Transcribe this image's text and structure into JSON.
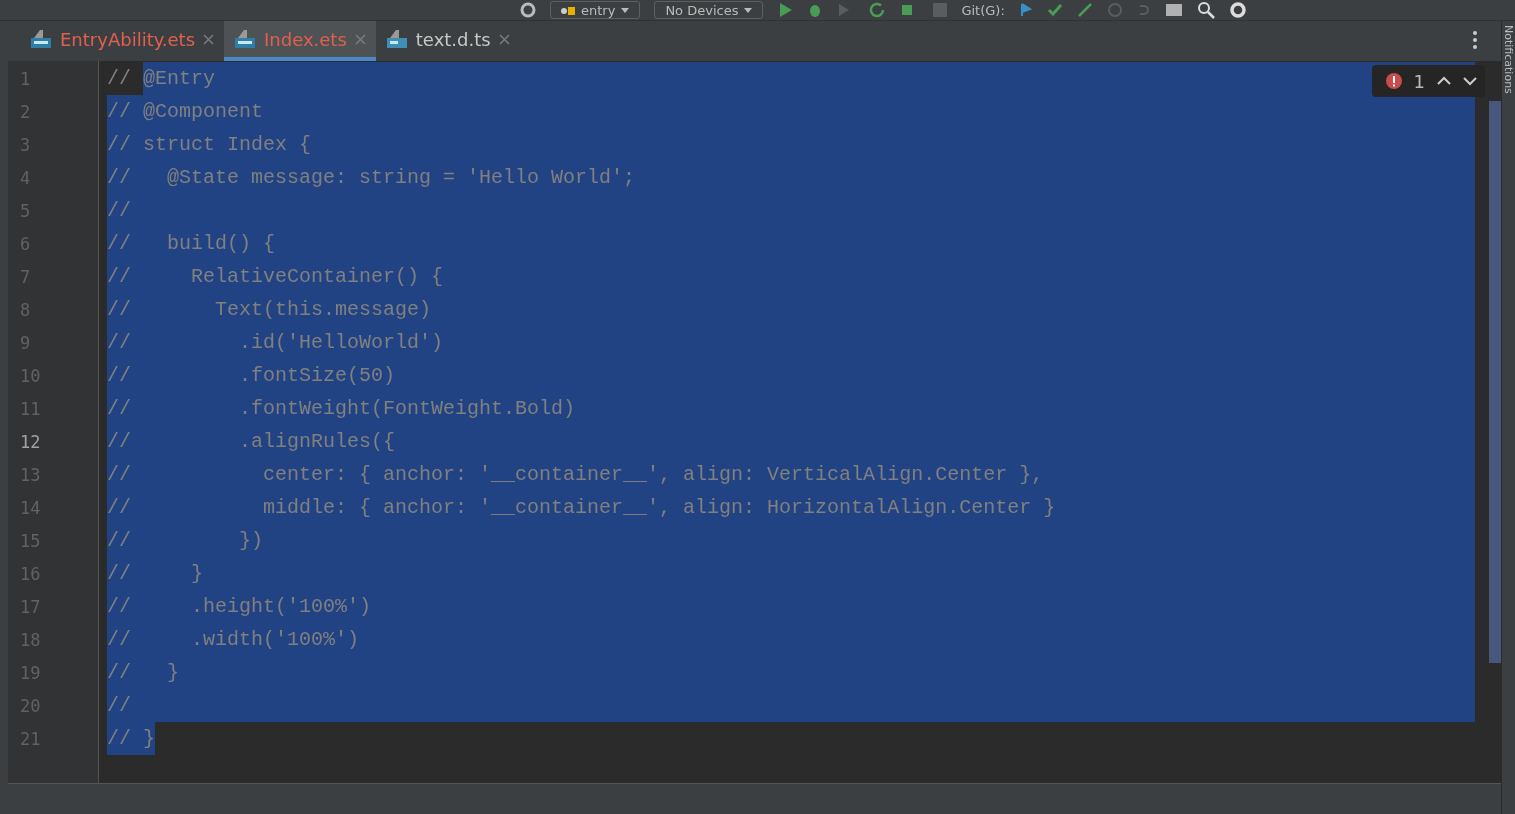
{
  "toolbar": {
    "module": "entry",
    "device": "No Devices",
    "vcs_label": "Git(G):"
  },
  "tabs": [
    {
      "label": "EntryAbility.ets",
      "kind": "ets",
      "modified": true,
      "selected": false
    },
    {
      "label": "Index.ets",
      "kind": "ets",
      "modified": true,
      "selected": true
    },
    {
      "label": "text.d.ts",
      "kind": "ts",
      "modified": false,
      "selected": false
    }
  ],
  "problems": {
    "errors": "1"
  },
  "side_panel": {
    "label": "Notifications"
  },
  "lines": [
    {
      "number": "1",
      "current": false,
      "eol_selected": true,
      "segments": [
        {
          "text": "// ",
          "selected": false
        },
        {
          "text": "@Entry",
          "selected": true
        }
      ]
    },
    {
      "number": "2",
      "current": false,
      "eol_selected": true,
      "segments": [
        {
          "text": "// @Component",
          "selected": true
        }
      ]
    },
    {
      "number": "3",
      "current": false,
      "eol_selected": true,
      "segments": [
        {
          "text": "// struct Index {",
          "selected": true
        }
      ]
    },
    {
      "number": "4",
      "current": false,
      "eol_selected": true,
      "segments": [
        {
          "text": "//   @State message: string = 'Hello World';",
          "selected": true
        }
      ]
    },
    {
      "number": "5",
      "current": false,
      "eol_selected": true,
      "segments": [
        {
          "text": "//",
          "selected": true
        }
      ]
    },
    {
      "number": "6",
      "current": false,
      "eol_selected": true,
      "segments": [
        {
          "text": "//   build() {",
          "selected": true
        }
      ]
    },
    {
      "number": "7",
      "current": false,
      "eol_selected": true,
      "segments": [
        {
          "text": "//     RelativeContainer() {",
          "selected": true
        }
      ]
    },
    {
      "number": "8",
      "current": false,
      "eol_selected": true,
      "segments": [
        {
          "text": "//       Text(this.message)",
          "selected": true
        }
      ]
    },
    {
      "number": "9",
      "current": false,
      "eol_selected": true,
      "segments": [
        {
          "text": "//         .id('HelloWorld')",
          "selected": true
        }
      ]
    },
    {
      "number": "10",
      "current": false,
      "eol_selected": true,
      "segments": [
        {
          "text": "//         .fontSize(50)",
          "selected": true
        }
      ]
    },
    {
      "number": "11",
      "current": false,
      "eol_selected": true,
      "segments": [
        {
          "text": "//         .fontWeight(FontWeight.Bold)",
          "selected": true
        }
      ]
    },
    {
      "number": "12",
      "current": true,
      "eol_selected": true,
      "segments": [
        {
          "text": "//         .alignRules({",
          "selected": true
        }
      ]
    },
    {
      "number": "13",
      "current": false,
      "eol_selected": true,
      "segments": [
        {
          "text": "//           center: { anchor: '__container__', align: VerticalAlign.Center },",
          "selected": true
        }
      ]
    },
    {
      "number": "14",
      "current": false,
      "eol_selected": true,
      "segments": [
        {
          "text": "//           middle: { anchor: '__container__', align: HorizontalAlign.Center }",
          "selected": true
        }
      ]
    },
    {
      "number": "15",
      "current": false,
      "eol_selected": true,
      "segments": [
        {
          "text": "//         })",
          "selected": true
        }
      ]
    },
    {
      "number": "16",
      "current": false,
      "eol_selected": true,
      "segments": [
        {
          "text": "//     }",
          "selected": true
        }
      ]
    },
    {
      "number": "17",
      "current": false,
      "eol_selected": true,
      "segments": [
        {
          "text": "//     .height('100%')",
          "selected": true
        }
      ]
    },
    {
      "number": "18",
      "current": false,
      "eol_selected": true,
      "segments": [
        {
          "text": "//     .width('100%')",
          "selected": true
        }
      ]
    },
    {
      "number": "19",
      "current": false,
      "eol_selected": true,
      "segments": [
        {
          "text": "//   }",
          "selected": true
        }
      ]
    },
    {
      "number": "20",
      "current": false,
      "eol_selected": true,
      "segments": [
        {
          "text": "//",
          "selected": true
        }
      ]
    },
    {
      "number": "21",
      "current": false,
      "eol_selected": false,
      "segments": [
        {
          "text": "// }",
          "selected": true
        }
      ]
    }
  ]
}
